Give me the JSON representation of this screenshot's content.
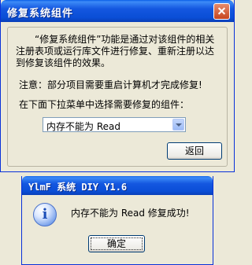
{
  "main_window": {
    "title": "修复系统组件",
    "description": "“修复系统组件”功能是通过对该组件的相关注册表项或运行库文件进行修复、重新注册以达到修复该组件的效果。",
    "note": "注意：部分项目需要重启计算机才完成修复!",
    "instruction": "在下面下拉菜单中选择需要修复的组件：",
    "component_select_value": "内存不能为 Read",
    "back_button": "返回"
  },
  "message_box": {
    "title": "YlmF 系统 DIY Y1.6",
    "message": "内存不能为 Read 修复成功!",
    "ok_button": "确定"
  }
}
